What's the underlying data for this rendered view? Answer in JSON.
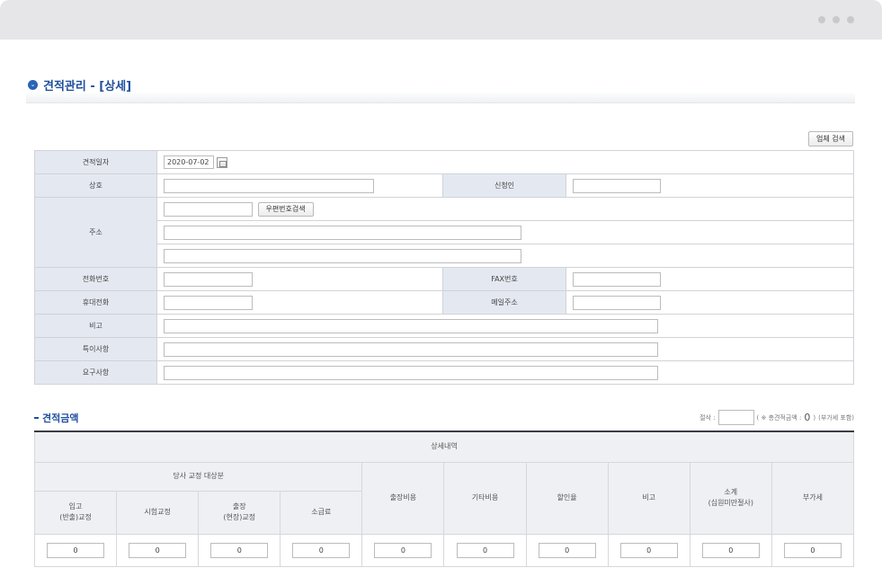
{
  "page": {
    "title": "견적관리 - [상세]",
    "vendor_search_label": "업체 검색"
  },
  "form": {
    "date_label": "견적일자",
    "date_value": "2020-07-02",
    "company_label": "상호",
    "applicant_label": "신청인",
    "address_label": "주소",
    "zip_search_label": "우편번호검색",
    "phone_label": "전화번호",
    "fax_label": "FAX번호",
    "mobile_label": "휴대전화",
    "email_label": "메일주소",
    "remark_label": "비고",
    "special_label": "특이사항",
    "request_label": "요구사항"
  },
  "amount": {
    "section_title": "견적금액",
    "cut_label": "절삭 :",
    "total_prefix": "( ※ 총견적금액 : ",
    "total_value": "0",
    "total_suffix": ")",
    "vat_note": "(부가세 포함)",
    "detail_header": "상세내역",
    "group_header": "당사 교정 대상분",
    "col_in": "입고\n(반출)교정",
    "col_test": "시험교정",
    "col_onsite": "출장\n(현장)교정",
    "col_subtotal_small": "소급료",
    "col_travel": "출장비용",
    "col_etc": "기타비용",
    "col_discount": "할인율",
    "col_remark": "비고",
    "col_subtotal": "소계\n(십원미만절사)",
    "col_vat": "부가세",
    "values": [
      "0",
      "0",
      "0",
      "0",
      "0",
      "0",
      "0",
      "0",
      "0",
      "0"
    ]
  }
}
